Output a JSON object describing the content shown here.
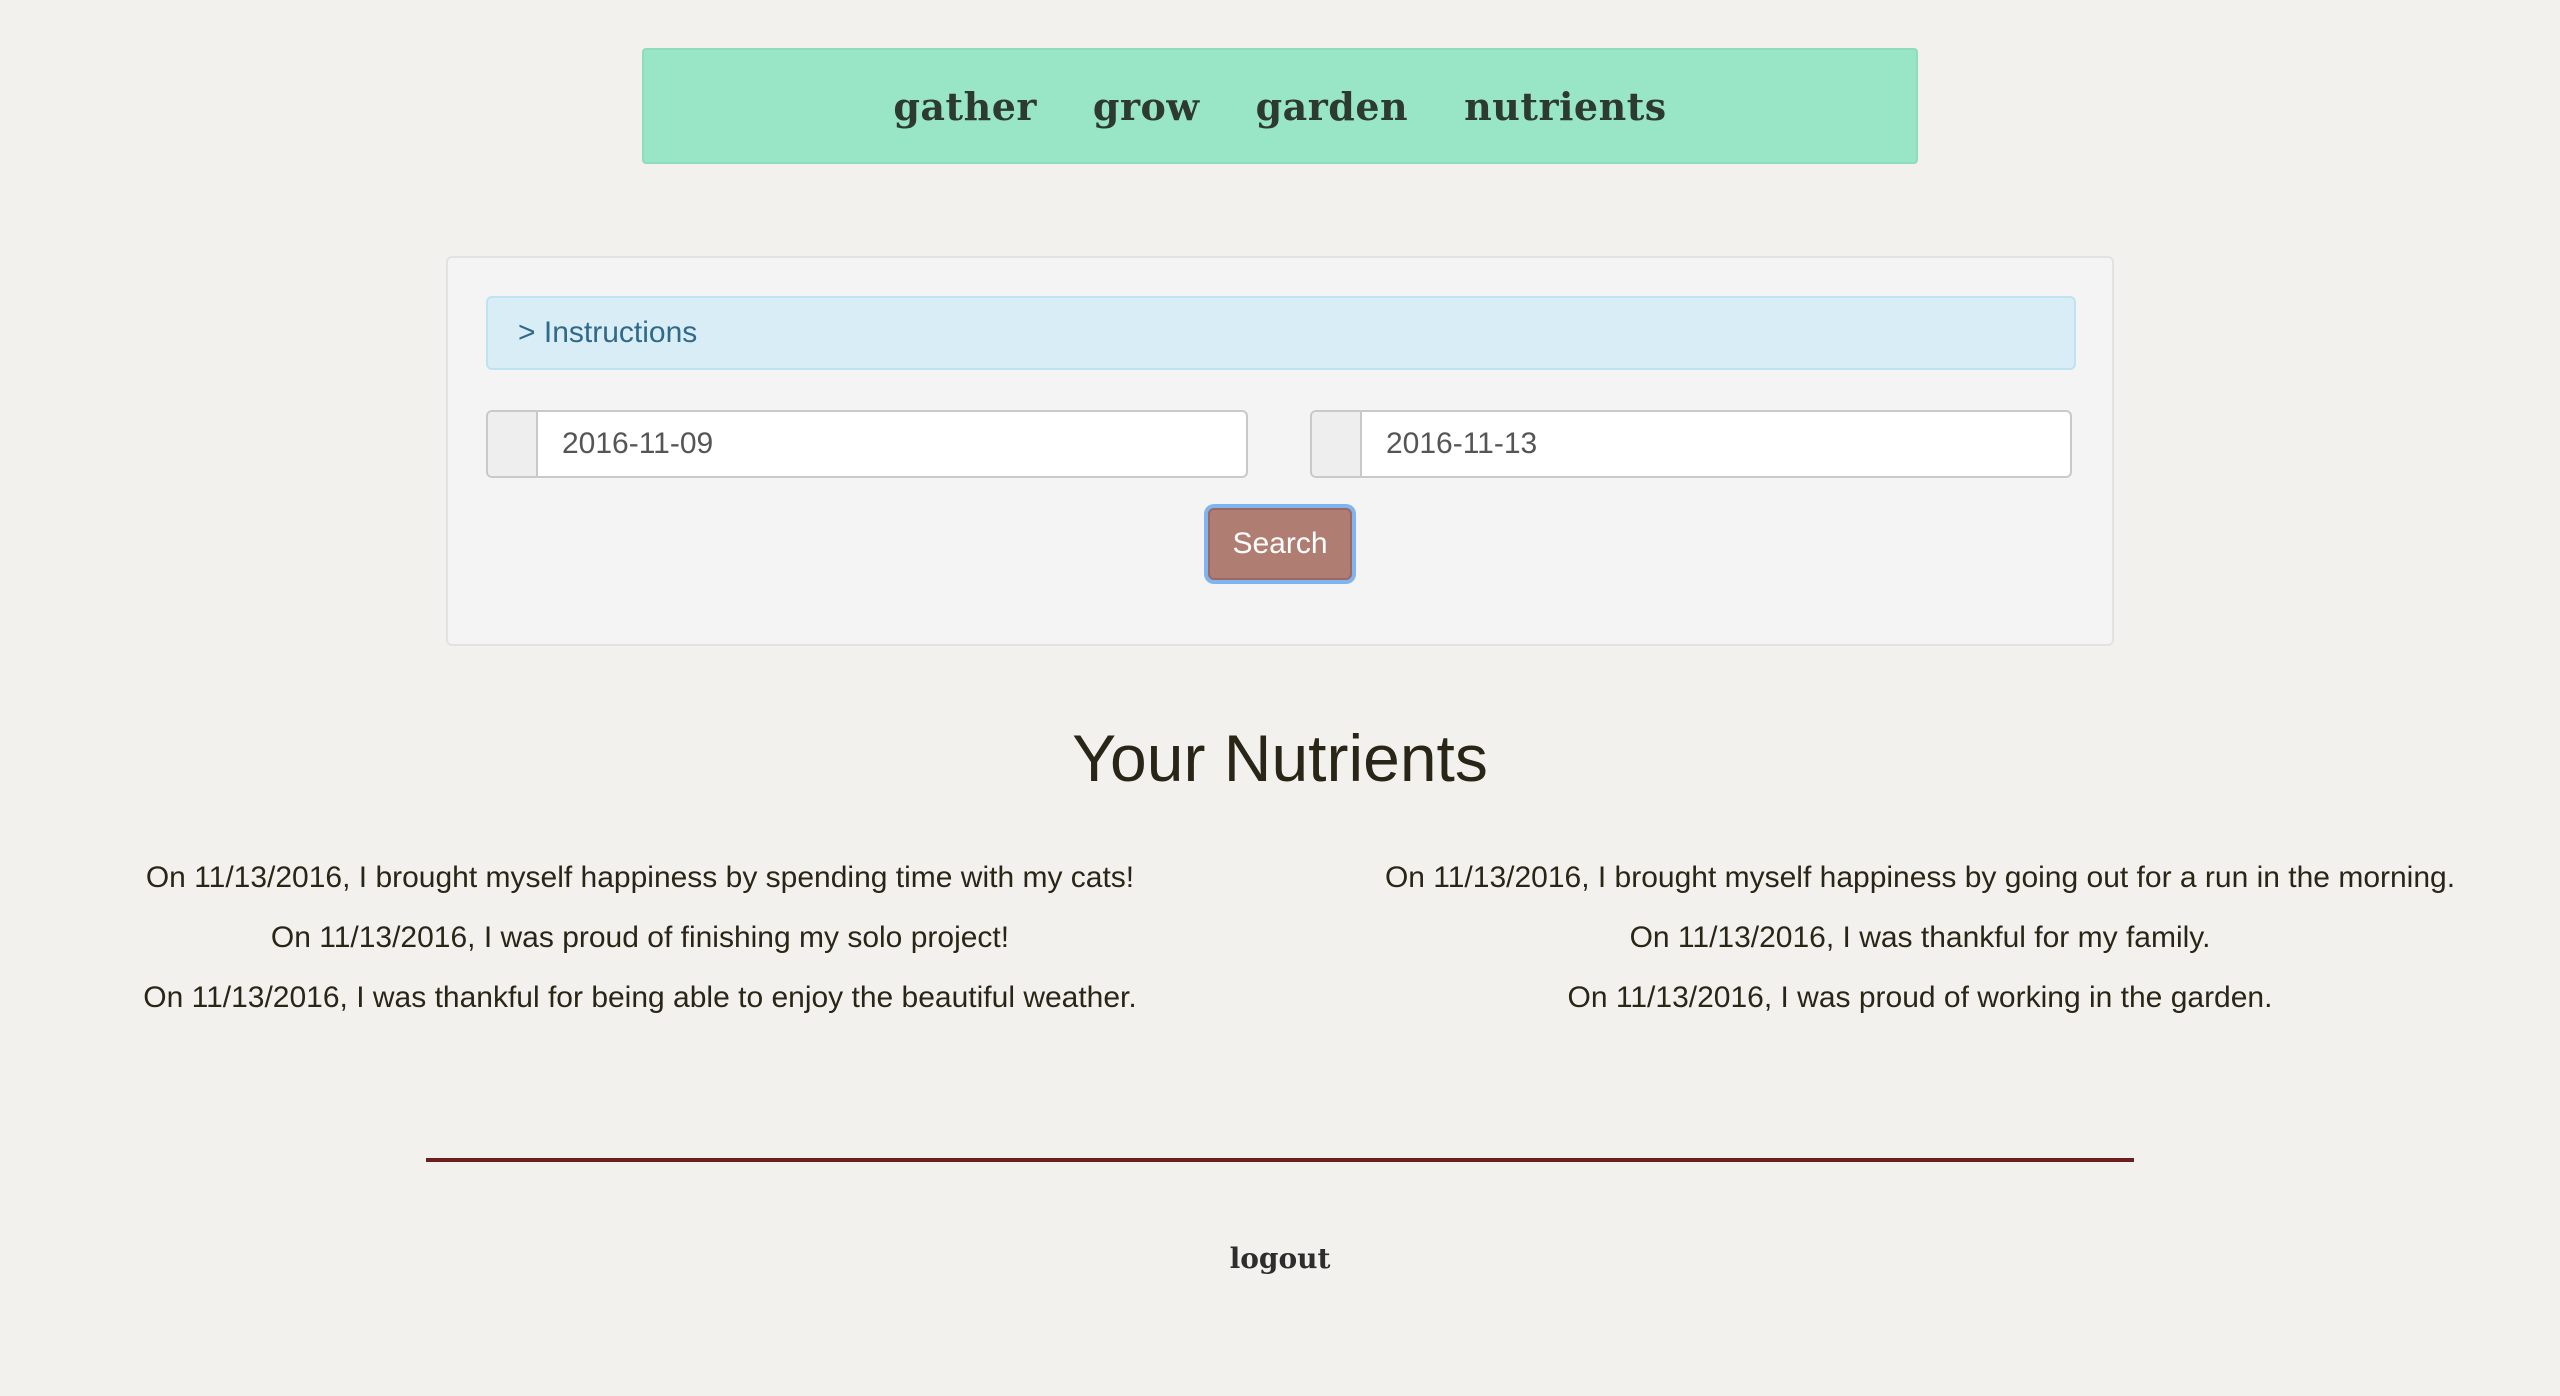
{
  "nav": {
    "items": [
      {
        "label": "gather"
      },
      {
        "label": "grow"
      },
      {
        "label": "garden"
      },
      {
        "label": "nutrients"
      }
    ]
  },
  "search_panel": {
    "instructions_label": "> Instructions",
    "start_date": "2016-11-09",
    "end_date": "2016-11-13",
    "search_label": "Search"
  },
  "nutrients": {
    "title": "Your Nutrients",
    "left": [
      "On 11/13/2016, I brought myself happiness by spending time with my cats!",
      "On 11/13/2016, I was proud of finishing my solo project!",
      "On 11/13/2016, I was thankful for being able to enjoy the beautiful weather."
    ],
    "right": [
      "On 11/13/2016, I brought myself happiness by going out for a run in the morning.",
      "On 11/13/2016, I was thankful for my family.",
      "On 11/13/2016, I was proud of working in the garden."
    ]
  },
  "footer": {
    "logout_label": "logout"
  },
  "colors": {
    "nav_bg": "#99e6c7",
    "instructions_bg": "#d9edf6",
    "search_button": "#b07d72",
    "divider": "#6a1e1e",
    "page_bg": "#f2f1ed"
  }
}
